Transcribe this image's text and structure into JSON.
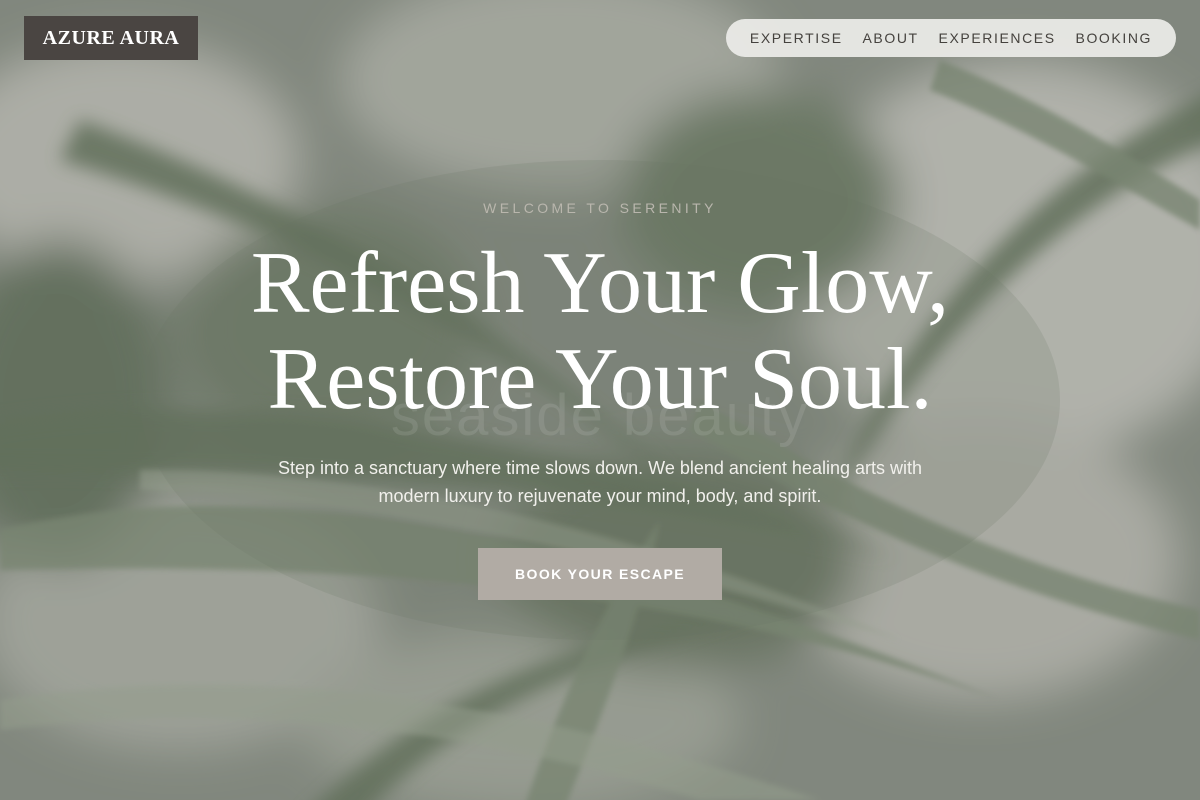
{
  "brand": {
    "name": "AZURE AURA"
  },
  "nav": {
    "items": [
      {
        "label": "EXPERTISE"
      },
      {
        "label": "ABOUT"
      },
      {
        "label": "EXPERIENCES"
      },
      {
        "label": "BOOKING"
      }
    ]
  },
  "hero": {
    "eyebrow": "WELCOME TO SERENITY",
    "headline_line1": "Refresh Your Glow,",
    "headline_line2": "Restore Your Soul.",
    "background_text": "seaside beauty",
    "subtext": "Step into a sanctuary where time slows down. We blend ancient healing arts with modern luxury to rejuvenate your mind, body, and spirit.",
    "cta_label": "BOOK YOUR ESCAPE"
  },
  "colors": {
    "brand_bg": "#4a4542",
    "nav_bg": "#ecece8",
    "cta_bg": "#b1aba4",
    "headline": "#ffffff",
    "overlay": "#7d857a"
  }
}
